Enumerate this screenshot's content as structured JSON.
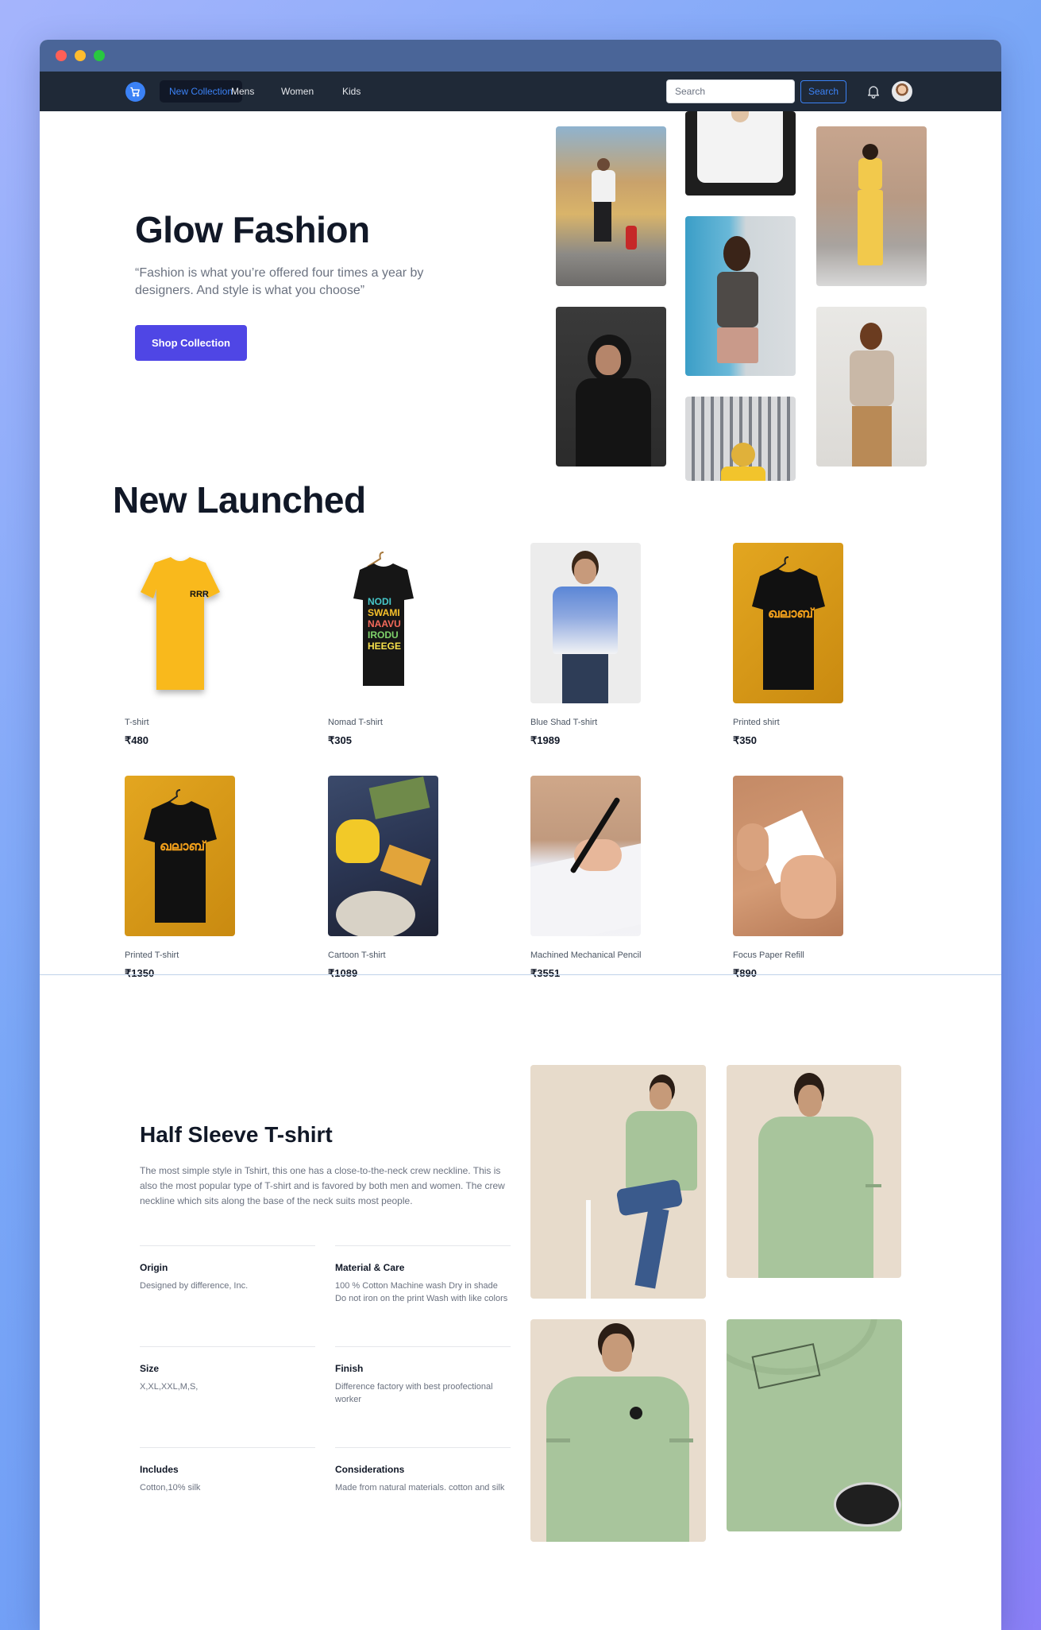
{
  "nav": {
    "items": [
      {
        "label": "New Collection",
        "active": true
      },
      {
        "label": "Mens",
        "active": false
      },
      {
        "label": "Women",
        "active": false
      },
      {
        "label": "Kids",
        "active": false
      }
    ],
    "search_placeholder": "Search",
    "search_button": "Search"
  },
  "hero": {
    "title": "Glow Fashion",
    "quote": "“Fashion is what you’re offered four times a year by designers. And style is what you choose”",
    "button": "Shop Collection"
  },
  "new_launched": {
    "title": "New Launched",
    "products": [
      {
        "name": "T-shirt",
        "price": "₹480"
      },
      {
        "name": "Nomad T-shirt",
        "price": "₹305"
      },
      {
        "name": "Blue Shad T-shirt",
        "price": "₹1989"
      },
      {
        "name": "Printed shirt",
        "price": "₹350"
      },
      {
        "name": "Printed T-shirt",
        "price": "₹1350"
      },
      {
        "name": "Cartoon T-shirt",
        "price": "₹1089"
      },
      {
        "name": "Machined Mechanical Pencil",
        "price": "₹3551"
      },
      {
        "name": "Focus Paper Refill",
        "price": "₹890"
      }
    ]
  },
  "detail": {
    "title": "Half Sleeve T-shirt",
    "description": "The most simple style in Tshirt, this one has a close-to-the-neck crew neckline. This is also the most popular type of T-shirt and is favored by both men and women. The crew neckline which sits along the base of the neck suits most people.",
    "specs": [
      {
        "label": "Origin",
        "value": "Designed by difference, Inc."
      },
      {
        "label": "Material & Care",
        "value": "100 % Cotton Machine wash Dry in shade Do not iron on the print Wash with like colors"
      },
      {
        "label": "Size",
        "value": "X,XL,XXL,M,S,"
      },
      {
        "label": "Finish",
        "value": "Difference factory with best proofectional worker"
      },
      {
        "label": "Includes",
        "value": "Cotton,10% silk"
      },
      {
        "label": "Considerations",
        "value": "Made from natural materials. cotton and silk"
      }
    ]
  },
  "colors": {
    "accent": "#4f46e5",
    "nav_bg": "#1f2937",
    "link_active": "#3b82f6"
  }
}
